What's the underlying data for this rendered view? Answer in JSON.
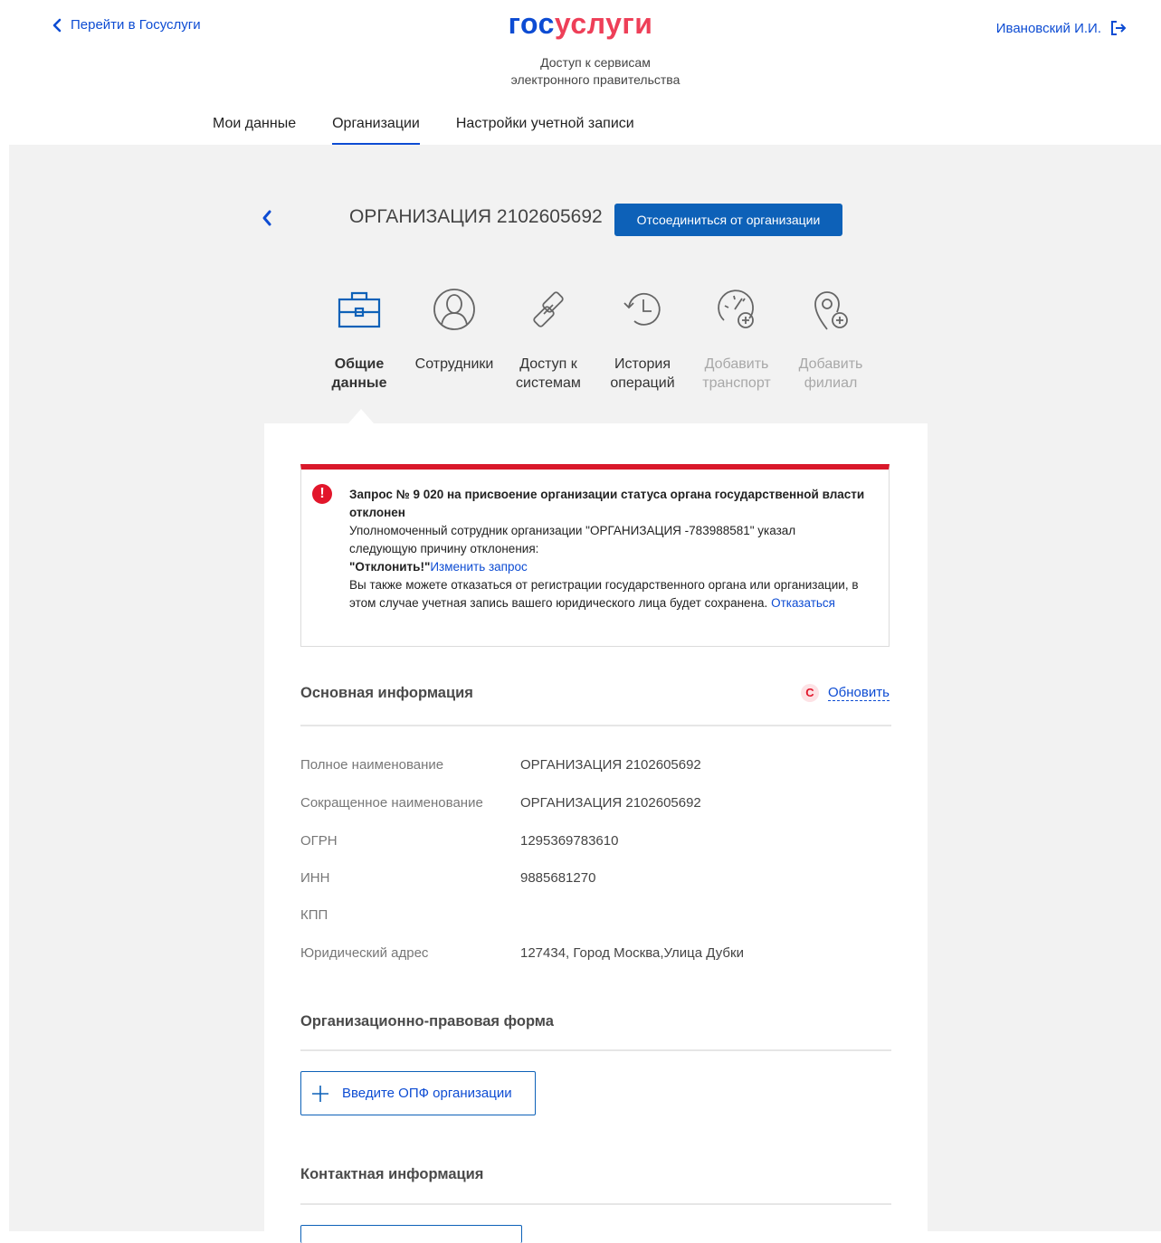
{
  "header": {
    "back_label": "Перейти в Госуслуги",
    "logo_part1": "гос",
    "logo_part2": "услуги",
    "subtitle_line1": "Доступ к сервисам",
    "subtitle_line2": "электронного правительства",
    "user_name": "Ивановский И.И."
  },
  "tabs": [
    {
      "label": "Мои данные",
      "active": false
    },
    {
      "label": "Организации",
      "active": true
    },
    {
      "label": "Настройки учетной записи",
      "active": false
    }
  ],
  "org": {
    "title": "ОРГАНИЗАЦИЯ 2102605692",
    "detach_label": "Отсоединиться от организации"
  },
  "nav": [
    {
      "line1": "Общие",
      "line2": "данные",
      "icon": "briefcase-icon",
      "state": "active"
    },
    {
      "line1": "Сотрудники",
      "line2": "",
      "icon": "person-icon",
      "state": "normal"
    },
    {
      "line1": "Доступ к",
      "line2": "системам",
      "icon": "link-icon",
      "state": "normal"
    },
    {
      "line1": "История",
      "line2": "операций",
      "icon": "history-icon",
      "state": "normal"
    },
    {
      "line1": "Добавить",
      "line2": "транспорт",
      "icon": "speedometer-add-icon",
      "state": "disabled"
    },
    {
      "line1": "Добавить",
      "line2": "филиал",
      "icon": "location-add-icon",
      "state": "disabled"
    }
  ],
  "alert": {
    "icon": "!",
    "title": "Запрос № 9 020 на присвоение организации статуса органа государственной власти отклонен",
    "body": "Уполномоченный сотрудник организации \"ОРГАНИЗАЦИЯ -783988581\" указал следующую причину отклонения:",
    "reason": "\"Отклонить!\"",
    "change_link": "Изменить запрос",
    "note": "Вы также можете отказаться от регистрации государственного органа или организации, в этом случае учетная запись вашего юридического лица будет сохранена.",
    "refuse_link": "Отказаться"
  },
  "main_info": {
    "heading": "Основная информация",
    "refresh_icon": "C",
    "refresh_label": "Обновить",
    "fields": [
      {
        "label": "Полное наименование",
        "value": "ОРГАНИЗАЦИЯ 2102605692"
      },
      {
        "label": "Сокращенное наименование",
        "value": "ОРГАНИЗАЦИЯ 2102605692"
      },
      {
        "label": "ОГРН",
        "value": "1295369783610"
      },
      {
        "label": "ИНН",
        "value": "9885681270"
      },
      {
        "label": "КПП",
        "value": ""
      },
      {
        "label": "Юридический адрес",
        "value": "127434, Город Москва,Улица Дубки"
      }
    ]
  },
  "opf": {
    "heading": "Организационно-правовая форма",
    "button_label": "Введите ОПФ организации"
  },
  "contacts": {
    "heading": "Контактная информация"
  },
  "colors": {
    "primary": "#0d4cd3",
    "button": "#0d61b8",
    "error": "#d9182a"
  }
}
